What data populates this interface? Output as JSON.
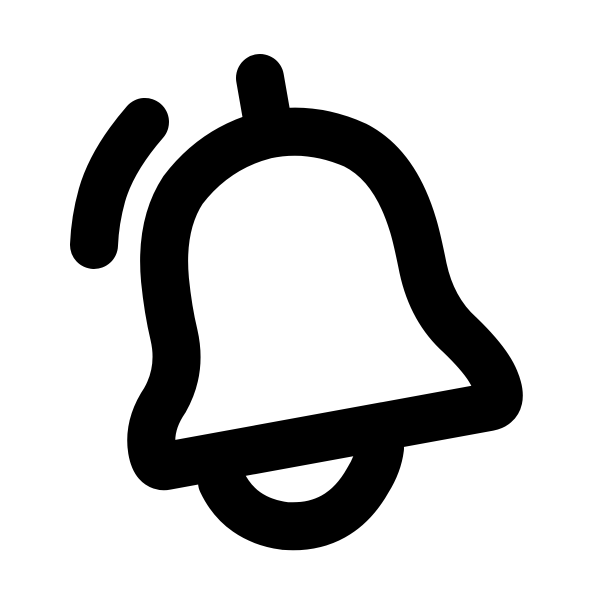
{
  "icon": {
    "name": "bell-ringing-icon",
    "stroke_color": "#000000",
    "background_color": "#ffffff"
  }
}
